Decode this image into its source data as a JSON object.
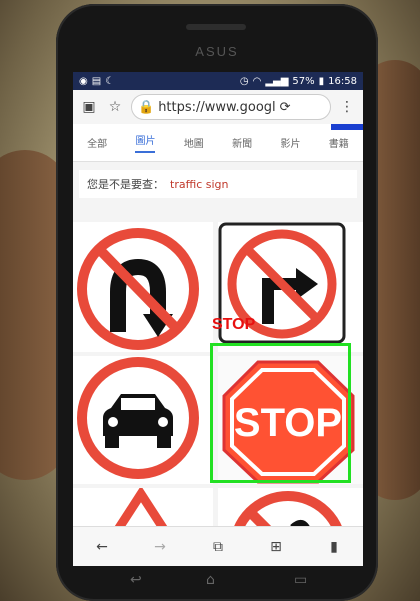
{
  "status_bar": {
    "battery": "57%",
    "time": "16:58"
  },
  "browser": {
    "url": "https://www.googl"
  },
  "tabs": [
    "全部",
    "圖片",
    "地圖",
    "新聞",
    "影片",
    "書籍"
  ],
  "active_tab": 1,
  "query": {
    "prompt": "您是不是要查：",
    "term": "traffic sign"
  },
  "detection": {
    "label": "STOP"
  },
  "stop_sign_text": "STOP",
  "phone_logo": "ASUS",
  "colors": {
    "status_bar": "#1d2b55",
    "accent": "#3a6fd8",
    "sign_red": "#e84a3a",
    "detection_box": "#22e022"
  }
}
